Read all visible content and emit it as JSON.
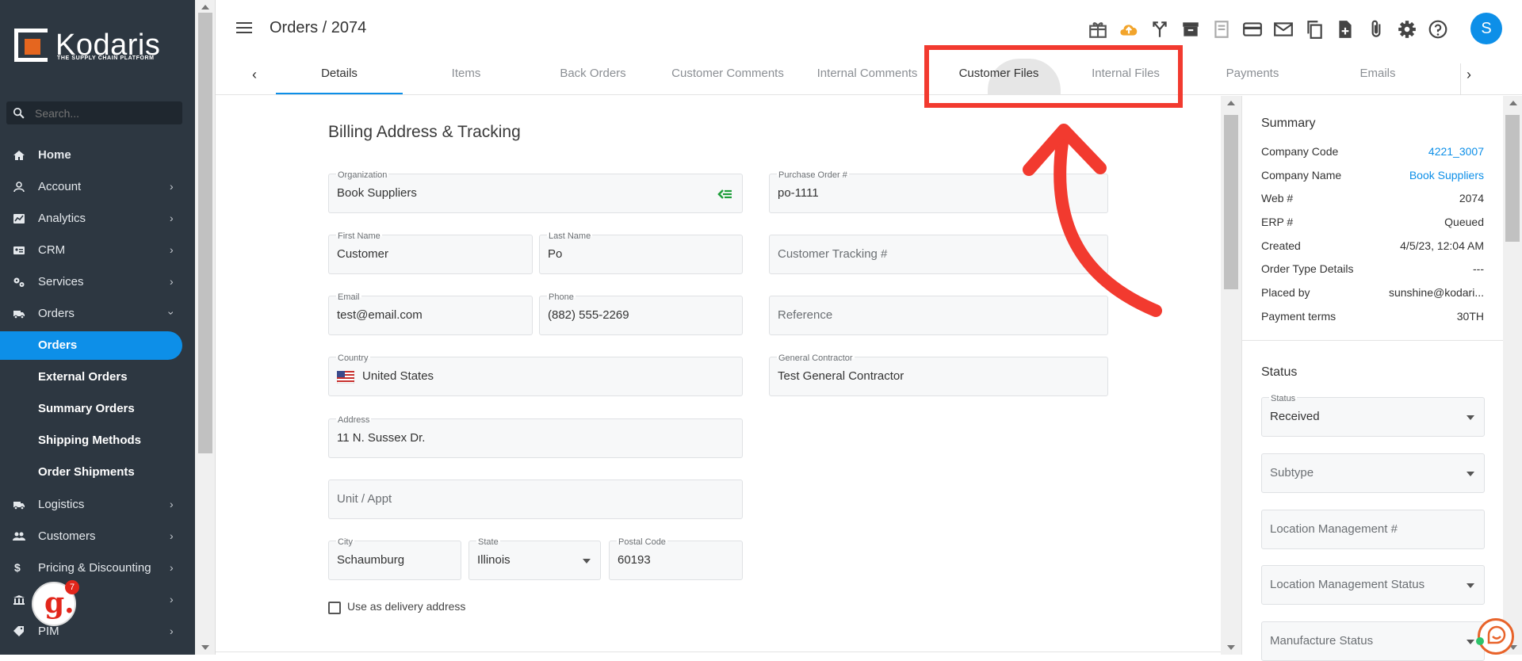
{
  "sidebar": {
    "logo": {
      "brand": "Kodaris",
      "tagline": "THE SUPPLY CHAIN PLATFORM"
    },
    "search_placeholder": "Search...",
    "items": [
      {
        "label": "Home",
        "icon": "home-icon"
      },
      {
        "label": "Account",
        "icon": "person-icon"
      },
      {
        "label": "Analytics",
        "icon": "chart-icon"
      },
      {
        "label": "CRM",
        "icon": "contact-card-icon"
      },
      {
        "label": "Services",
        "icon": "gears-icon"
      },
      {
        "label": "Orders",
        "icon": "truck-icon"
      }
    ],
    "sub_items": [
      {
        "label": "Orders"
      },
      {
        "label": "External Orders"
      },
      {
        "label": "Summary Orders"
      },
      {
        "label": "Shipping Methods"
      },
      {
        "label": "Order Shipments"
      }
    ],
    "items_lower": [
      {
        "label": "Logistics",
        "icon": "truck-icon"
      },
      {
        "label": "Customers",
        "icon": "people-icon"
      },
      {
        "label": "Pricing & Discounting",
        "icon": "dollar-icon"
      },
      {
        "label": "",
        "icon": "bank-icon"
      },
      {
        "label": "PIM",
        "icon": "tag-icon"
      }
    ],
    "badge_count": "7"
  },
  "header": {
    "title": "Orders / 2074",
    "avatar": "S",
    "toolbar_icons": [
      "gift-icon",
      "cloud-upload-icon",
      "merge-icon",
      "archive-icon",
      "receipt-icon",
      "credit-card-icon",
      "mail-icon",
      "copy-icon",
      "file-add-icon",
      "attachment-icon",
      "gear-icon",
      "help-icon"
    ]
  },
  "tabs": [
    {
      "label": "Details"
    },
    {
      "label": "Items"
    },
    {
      "label": "Back Orders"
    },
    {
      "label": "Customer Comments"
    },
    {
      "label": "Internal Comments"
    },
    {
      "label": "Customer Files"
    },
    {
      "label": "Internal Files"
    },
    {
      "label": "Payments"
    },
    {
      "label": "Emails"
    }
  ],
  "form": {
    "section_title": "Billing Address & Tracking",
    "organization": {
      "label": "Organization",
      "value": "Book Suppliers"
    },
    "po": {
      "label": "Purchase Order #",
      "value": "po-1111"
    },
    "first_name": {
      "label": "First Name",
      "value": "Customer"
    },
    "last_name": {
      "label": "Last Name",
      "value": "Po"
    },
    "tracking": {
      "placeholder": "Customer Tracking #"
    },
    "email": {
      "label": "Email",
      "value": "test@email.com"
    },
    "phone": {
      "label": "Phone",
      "value": "(882) 555-2269"
    },
    "reference": {
      "placeholder": "Reference"
    },
    "country": {
      "label": "Country",
      "value": "United States"
    },
    "contractor": {
      "label": "General Contractor",
      "value": "Test General Contractor"
    },
    "address": {
      "label": "Address",
      "value": "11 N. Sussex Dr."
    },
    "unit": {
      "placeholder": "Unit / Appt"
    },
    "city": {
      "label": "City",
      "value": "Schaumburg"
    },
    "state": {
      "label": "State",
      "value": "Illinois"
    },
    "postal": {
      "label": "Postal Code",
      "value": "60193"
    },
    "delivery_checkbox": "Use as delivery address"
  },
  "summary": {
    "title": "Summary",
    "rows": [
      {
        "key": "Company Code",
        "value": "4221_3007"
      },
      {
        "key": "Company Name",
        "value": "Book Suppliers"
      },
      {
        "key": "Web #",
        "value": "2074"
      },
      {
        "key": "ERP #",
        "value": "Queued"
      },
      {
        "key": "Created",
        "value": "4/5/23, 12:04 AM"
      },
      {
        "key": "Order Type Details",
        "value": "---"
      },
      {
        "key": "Placed by",
        "value": "sunshine@kodari..."
      },
      {
        "key": "Payment terms",
        "value": "30TH"
      }
    ]
  },
  "status": {
    "title": "Status",
    "status_field": {
      "label": "Status",
      "value": "Received"
    },
    "subtype": {
      "placeholder": "Subtype"
    },
    "location_mgmt": {
      "placeholder": "Location Management #"
    },
    "location_status": {
      "placeholder": "Location Management Status"
    },
    "manufacture_status": {
      "placeholder": "Manufacture Status"
    }
  },
  "colors": {
    "accent": "#0d8fe8",
    "sidebar": "#2d3741",
    "highlight": "#f23a2f",
    "logo_orange": "#e5661f"
  }
}
